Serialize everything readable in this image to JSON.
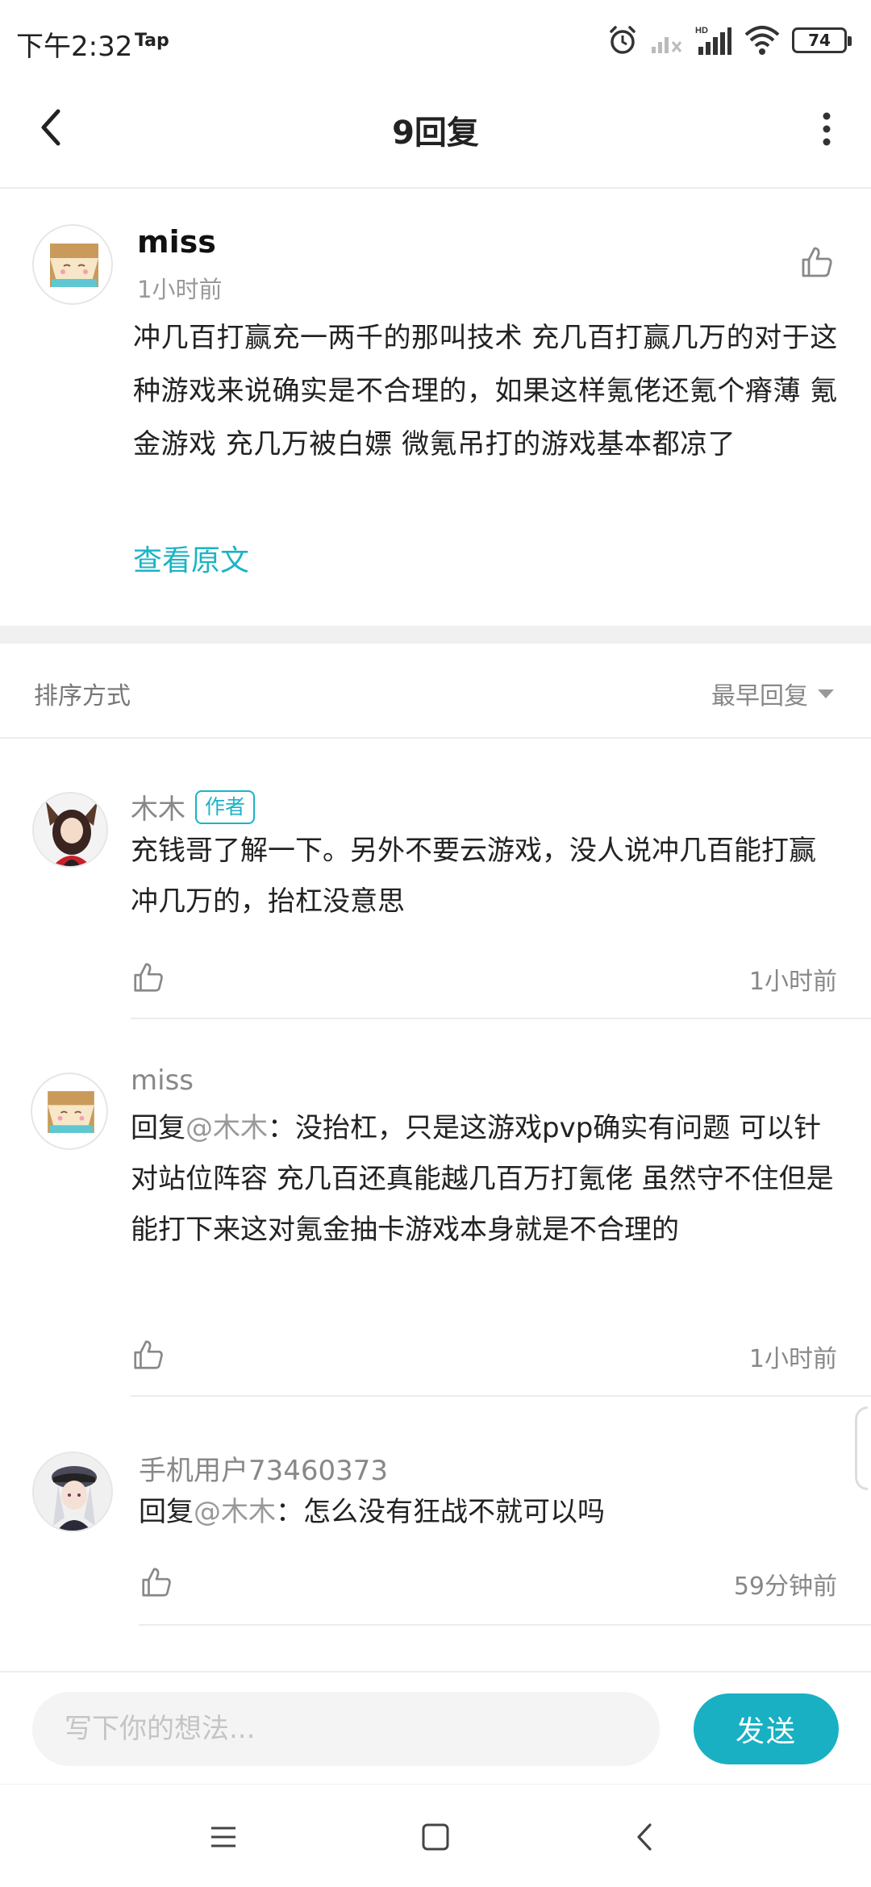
{
  "status_bar": {
    "time": "下午2:32",
    "tap_label": "Tap",
    "battery": "74"
  },
  "header": {
    "title": "9回复"
  },
  "main_post": {
    "author": "miss",
    "time": "1小时前",
    "content": "冲几百打赢充一两千的那叫技术   充几百打赢几万的对于这种游戏来说确实是不合理的，如果这样氪佬还氪个瘠薄  氪金游戏 充几万被白嫖 微氪吊打的游戏基本都凉了",
    "view_original": "查看原文"
  },
  "sort": {
    "label": "排序方式",
    "selected": "最早回复"
  },
  "replies": [
    {
      "author": "木木",
      "badge": "作者",
      "reply_prefix": "",
      "mention": "",
      "text": "充钱哥了解一下。另外不要云游戏，没人说冲几百能打赢冲几万的，抬杠没意思",
      "time": "1小时前"
    },
    {
      "author": "miss",
      "badge": "",
      "reply_prefix": "回复",
      "mention": "@木木",
      "text": "：没抬杠，只是这游戏pvp确实有问题 可以针对站位阵容  充几百还真能越几百万打氪佬 虽然守不住但是能打下来这对氪金抽卡游戏本身就是不合理的",
      "time": "1小时前"
    },
    {
      "author": "手机用户73460373",
      "badge": "",
      "reply_prefix": "回复",
      "mention": "@木木",
      "text": "：怎么没有狂战不就可以吗",
      "time": "59分钟前"
    }
  ],
  "input": {
    "placeholder": "写下你的想法...",
    "send_label": "发送"
  },
  "colors": {
    "accent": "#19b0c3",
    "link": "#1bb3c6"
  },
  "icons": [
    "alarm-icon",
    "signal-icon",
    "wifi-icon",
    "battery-icon",
    "back-arrow-icon",
    "more-vertical-icon",
    "thumbs-up-icon",
    "dropdown-triangle-icon",
    "menu-icon",
    "home-square-icon",
    "back-chevron-icon"
  ]
}
